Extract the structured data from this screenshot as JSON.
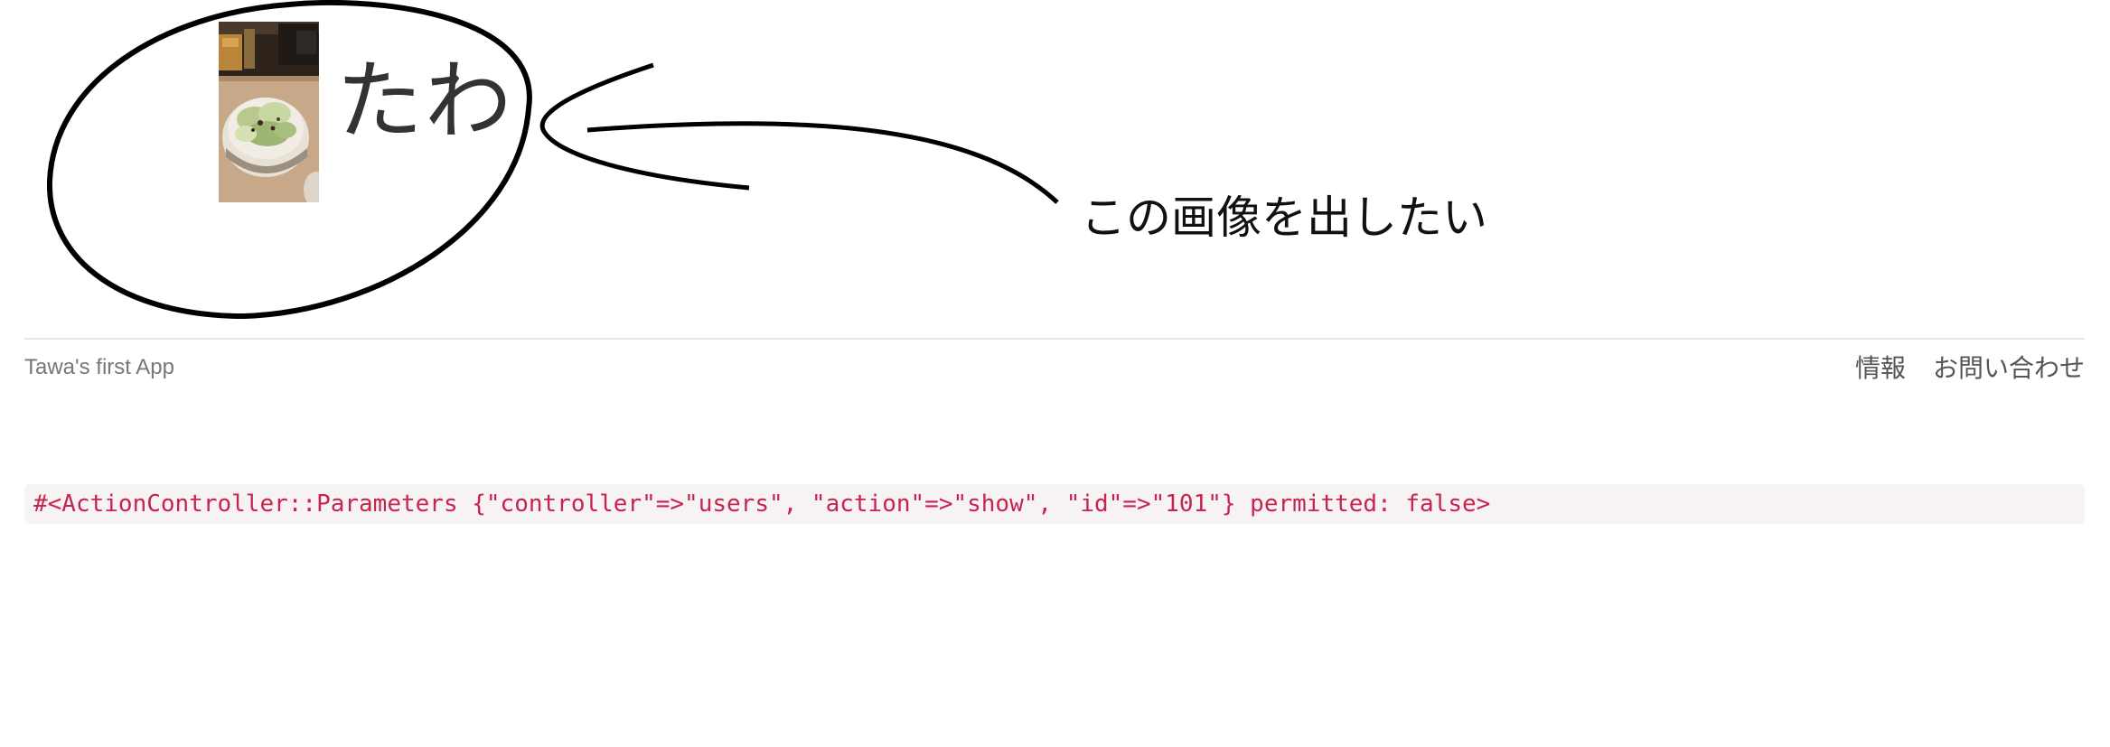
{
  "profile": {
    "name": "たわ",
    "photo_icon": "salad-photo"
  },
  "annotation": {
    "note": "この画像を出したい"
  },
  "footer": {
    "brand": "Tawa's first App",
    "links": [
      {
        "label": "情報"
      },
      {
        "label": "お問い合わせ"
      }
    ]
  },
  "debug": {
    "params": "#<ActionController::Parameters {\"controller\"=>\"users\", \"action\"=>\"show\", \"id\"=>\"101\"} permitted: false>"
  },
  "colors": {
    "debug_text": "#c7254e",
    "debug_bg": "#f7f2f4",
    "name_text": "#333333",
    "footer_text": "#777777"
  }
}
